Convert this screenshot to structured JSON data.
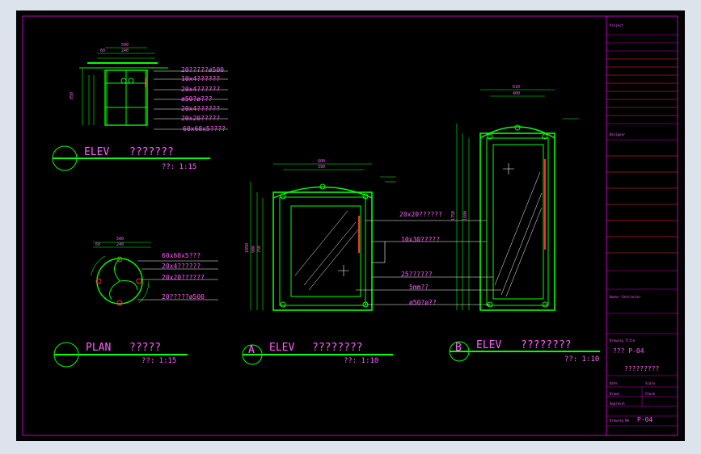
{
  "colors": {
    "background": "#000000",
    "frame": "#c000c0",
    "geometry": "#00ff00",
    "text": "#ff5cff",
    "leader": "#ffffff",
    "accent": "#ff3030"
  },
  "views": {
    "elev_small": {
      "title": "ELEV",
      "subtitle": "???????",
      "scale": "??: 1:15"
    },
    "plan": {
      "title": "PLAN",
      "subtitle": "?????",
      "scale": "??: 1:15"
    },
    "elev_a": {
      "bubble": "A",
      "title": "ELEV",
      "subtitle": "????????",
      "scale": "??: 1:10"
    },
    "elev_b": {
      "bubble": "B",
      "title": "ELEV",
      "subtitle": "????????",
      "scale": "??: 1:10"
    }
  },
  "callouts_small": [
    "20?????ø500",
    "10x4??????",
    "20x4??????",
    "ø50?ø???",
    "20x4??????",
    "20x20?????",
    "60x60x5????"
  ],
  "callouts_plan": [
    "60x60x5???",
    "20x4??????",
    "20x20??????",
    "20?????ø500"
  ],
  "callouts_doors": [
    "20x20??????",
    "10x30?????",
    "25??????",
    "5mm??",
    "ø50?ø??"
  ],
  "dims": {
    "small_top": [
      "500",
      "240",
      "60"
    ],
    "small_left": [
      "850"
    ],
    "plan_top": [
      "500",
      "240",
      "60"
    ],
    "a_top": [
      "600",
      "390"
    ],
    "a_left": [
      "1050",
      "900",
      "750"
    ],
    "b_top": [
      "610",
      "400"
    ],
    "b_left": [
      "1750",
      "1600"
    ]
  },
  "title_block": {
    "project_label": "Project",
    "designer_label": "Designer",
    "consultant_label": "Owner Contractor",
    "drawing_title_label": "Drawing Title",
    "drawing_title_value": "?????????",
    "sheet_label": "??? P-04",
    "rows": [
      "Date",
      "Scale",
      "Drawn",
      "Check",
      "Approval"
    ],
    "sheet_no_label": "Drawing No.",
    "sheet_no": "P-04"
  }
}
